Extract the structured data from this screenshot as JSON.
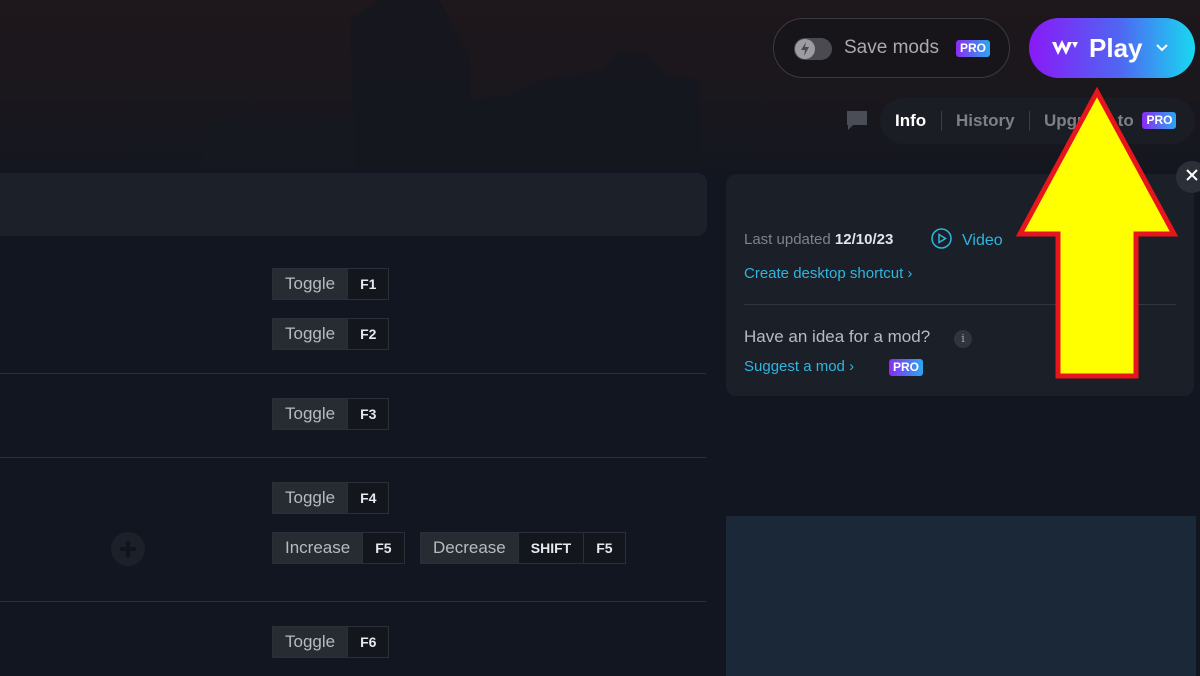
{
  "header": {
    "save_mods": {
      "label": "Save mods",
      "badge": "PRO",
      "toggle_on": false,
      "toggle_icon": "lightning-icon"
    },
    "play_button": {
      "label": "Play",
      "logo_icon": "wemod-logo-icon",
      "dropdown_icon": "chevron-down-icon"
    },
    "chat_icon": "chat-bubble-icon",
    "tabs": [
      {
        "label": "Info",
        "active": true
      },
      {
        "label": "History",
        "active": false
      },
      {
        "label": "Upgrade to",
        "badge": "PRO",
        "active": false
      }
    ]
  },
  "mods": {
    "rows": [
      {
        "controls": [
          {
            "label": "Toggle",
            "keys": [
              "F1"
            ]
          }
        ]
      },
      {
        "controls": [
          {
            "label": "Toggle",
            "keys": [
              "F2"
            ]
          }
        ]
      },
      {
        "controls": [
          {
            "label": "Toggle",
            "keys": [
              "F3"
            ]
          }
        ]
      },
      {
        "controls": [
          {
            "label": "Toggle",
            "keys": [
              "F4"
            ]
          }
        ]
      },
      {
        "controls": [
          {
            "label": "Increase",
            "keys": [
              "F5"
            ]
          },
          {
            "label": "Decrease",
            "keys": [
              "SHIFT",
              "F5"
            ]
          }
        ]
      },
      {
        "controls": [
          {
            "label": "Toggle",
            "keys": [
              "F6"
            ]
          }
        ]
      }
    ]
  },
  "info_panel": {
    "last_updated_label": "Last updated",
    "last_updated_date": "12/10/23",
    "video_label": "Video",
    "desktop_shortcut_label": "Create desktop shortcut ›",
    "idea_question": "Have an idea for a mod?",
    "info_icon": "i",
    "suggest_label": "Suggest a mod ›",
    "suggest_badge": "PRO",
    "close_icon": "close-icon"
  },
  "annotation": {
    "type": "arrow",
    "color_fill": "#ffff00",
    "color_stroke": "#e8161c",
    "points_to": "play-button"
  }
}
